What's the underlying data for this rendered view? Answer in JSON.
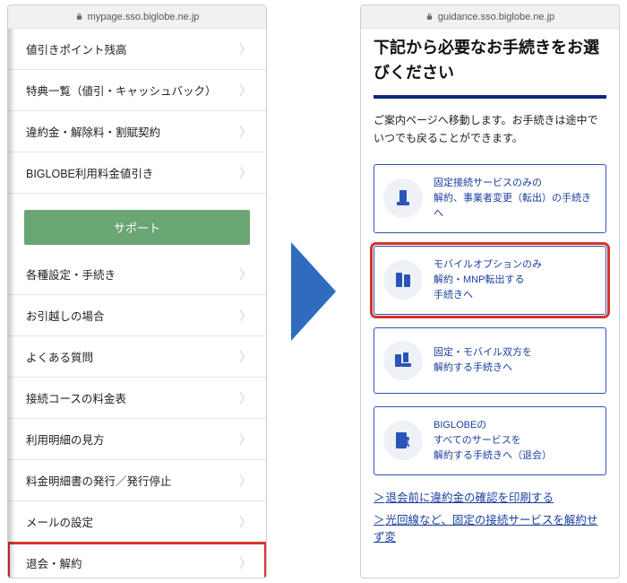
{
  "left": {
    "url": "mypage.sso.biglobe.ne.jp",
    "rows_top": [
      "値引きポイント残高",
      "特典一覧（値引・キャッシュバック）",
      "違約金・解除料・割賦契約",
      "BIGLOBE利用料金値引き"
    ],
    "support_label": "サポート",
    "rows_bottom": [
      "各種設定・手続き",
      "お引越しの場合",
      "よくある質問",
      "接続コースの料金表",
      "利用明細の見方",
      "料金明細書の発行／発行停止",
      "メールの設定",
      "退会・解約"
    ],
    "highlight_index": 7
  },
  "right": {
    "url": "guidance.sso.biglobe.ne.jp",
    "title": "下記から必要なお手続きをお選びください",
    "desc": "ご案内ページへ移動します。お手続きは途中でいつでも戻ることができます。",
    "cards": [
      {
        "l1": "固定接続サービスのみの",
        "l2": "解約、事業者変更（転出）の手続きへ",
        "l3": ""
      },
      {
        "l1": "モバイルオプションのみ",
        "l2": "解約・MNP転出する",
        "l3": "手続きへ"
      },
      {
        "l1": "固定・モバイル双方を",
        "l2": "解約する手続きへ",
        "l3": ""
      },
      {
        "l1": "BIGLOBEの",
        "l2": "すべてのサービスを",
        "l3": "解約する手続きへ（退会）"
      }
    ],
    "highlight_index": 1,
    "links": [
      "退会前に違約金の確認を印刷する",
      "光回線など、固定の接続サービスを解約せず変"
    ]
  }
}
